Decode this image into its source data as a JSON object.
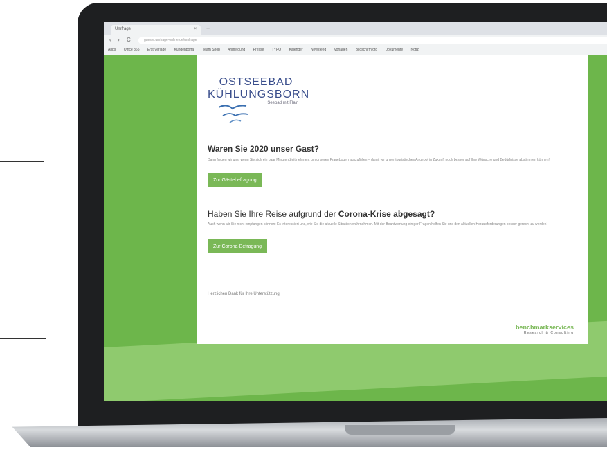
{
  "browser": {
    "tab_title": "Umfrage",
    "tab_close": "×",
    "new_tab": "+",
    "nav_back": "‹",
    "nav_forward": "›",
    "nav_reload": "C",
    "url": "gaeste.umfrage-online.de/umfrage",
    "bookmarks": [
      "Apps",
      "Office 365",
      "Erst Verlage",
      "Kundenportal",
      "Team Shop",
      "Anmeldung",
      "Presse",
      "TYPO",
      "Kalender",
      "Newsfeed",
      "Vorlagen",
      "Bildschirmfoto",
      "Dokumente",
      "Notiz"
    ]
  },
  "logo": {
    "line1": "OSTSEEBAD",
    "line2": "KÜHLUNGSBORN",
    "line3": "Seebad mit Flair"
  },
  "section1": {
    "title": "Waren Sie 2020 unser Gast?",
    "text": "Dann freuen wir uns, wenn Sie sich ein paar Minuten Zeit nehmen, um unseren Fragebogen auszufüllen – damit wir unser touristisches Angebot in Zukunft noch besser auf Ihre Wünsche und Bedürfnisse abstimmen können!",
    "button": "Zur Gästebefragung"
  },
  "section2": {
    "title_plain": "Haben Sie Ihre Reise aufgrund der ",
    "title_bold": "Corona-Krise abgesagt?",
    "text": "Auch wenn wir Sie nicht empfangen können: Es interessiert uns, wie Sie die aktuelle Situation wahrnehmen. Mit der Beantwortung einiger Fragen helfen Sie uns den aktuellen Herausforderungen besser gerecht zu werden!",
    "button": "Zur Corona-Befragung"
  },
  "thanks": "Herzlichen Dank für Ihre Unterstützung!",
  "brand": {
    "name": "benchmarkservices",
    "tagline": "Research & Consulting"
  },
  "colors": {
    "page_green": "#6db64b",
    "button_green": "#7ab857",
    "logo_blue": "#3a4e8c"
  }
}
